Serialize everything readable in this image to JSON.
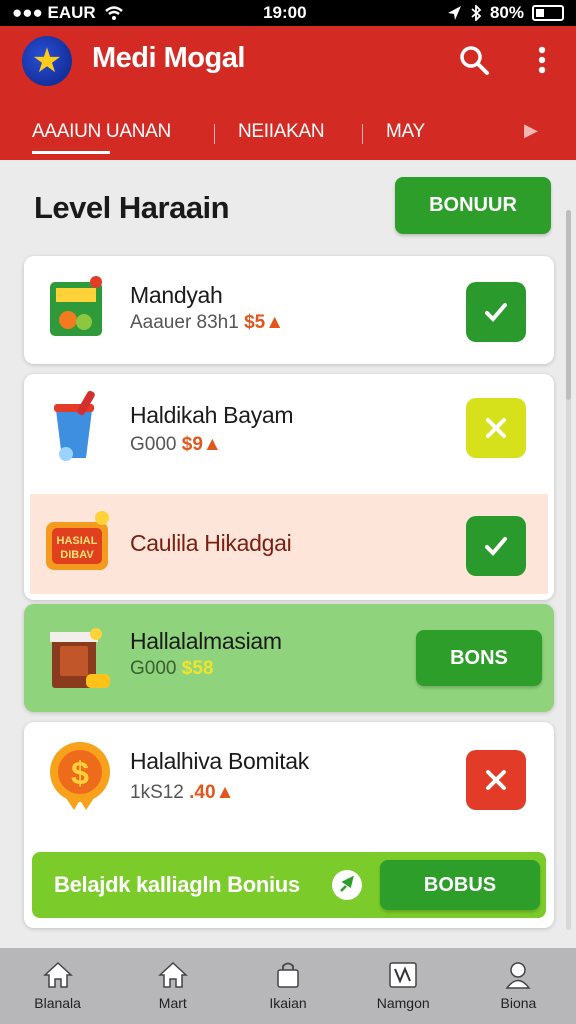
{
  "status_bar": {
    "carrier": "●●● EAUR",
    "time": "19:00",
    "battery": "80%"
  },
  "app": {
    "title": "Medi Mogal",
    "logo_icon": "star-icon"
  },
  "tabs": [
    {
      "label": "AAAIUN UANAN"
    },
    {
      "label": "NEIIAKAN"
    },
    {
      "label": "MAY"
    }
  ],
  "section": {
    "title": "Level Haraain",
    "bonus_label": "BONUUR"
  },
  "items": [
    {
      "name": "Mandyah",
      "meta": "Aaauer 83h1",
      "price": "$5▲",
      "action": "check",
      "action_color": "#2a9a2c"
    },
    {
      "name": "Haldikah Bayam",
      "meta": "G000",
      "price": "$9▲",
      "action": "close",
      "action_color": "#d7e11b"
    },
    {
      "name": "Caulila Hikadgai",
      "action": "check",
      "action_color": "#2a9a2c"
    },
    {
      "name": "Hallalalmasiam",
      "meta": "G000",
      "price": "$58",
      "action_label": "BONS"
    },
    {
      "name": "Halalhiva Bomitak",
      "meta": "1kS12",
      "price": ".40▲",
      "action": "close",
      "action_color": "#e23b27"
    }
  ],
  "banner": {
    "text": "Belajdk kalliagln Bonius",
    "button_label": "BOBUS"
  },
  "bottom_nav": [
    {
      "label": "Blanala",
      "icon": "home-icon"
    },
    {
      "label": "Mart",
      "icon": "home-icon"
    },
    {
      "label": "Ikaian",
      "icon": "bag-icon"
    },
    {
      "label": "Namgon",
      "icon": "chart-icon"
    },
    {
      "label": "Biona",
      "icon": "person-icon"
    }
  ],
  "colors": {
    "brand_red": "#d42a24",
    "green": "#2d9e2a",
    "lime": "#8fd34a",
    "orange": "#e2561c"
  }
}
